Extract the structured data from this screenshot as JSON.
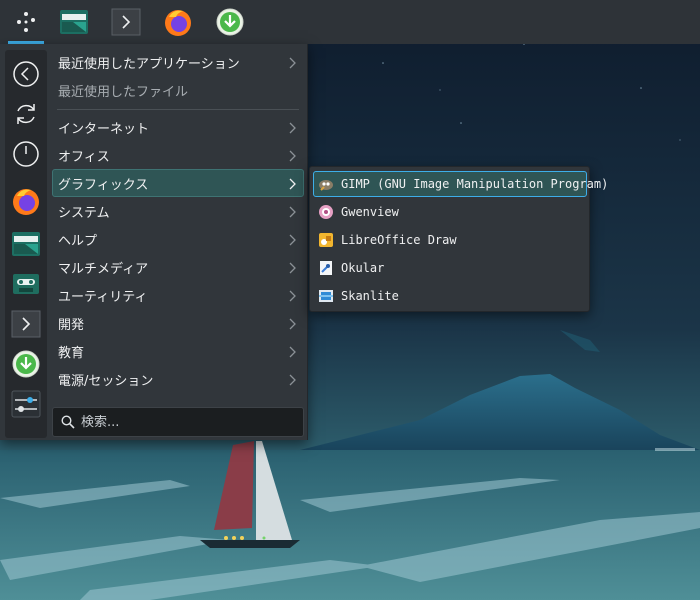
{
  "panel": {
    "items": [
      {
        "name": "application-launcher",
        "icon": "launcher-dots-icon",
        "active": true
      },
      {
        "name": "file-manager",
        "icon": "folder-icon"
      },
      {
        "name": "terminal",
        "icon": "terminal-icon"
      },
      {
        "name": "firefox",
        "icon": "firefox-icon"
      },
      {
        "name": "updater",
        "icon": "download-icon"
      }
    ]
  },
  "sidebar": {
    "items": [
      {
        "icon": "back-arrow-icon"
      },
      {
        "icon": "refresh-icon"
      },
      {
        "icon": "power-icon"
      },
      {
        "icon": "firefox-icon"
      },
      {
        "icon": "folder-icon"
      },
      {
        "icon": "cassette-icon"
      },
      {
        "icon": "terminal-icon"
      },
      {
        "icon": "download-icon"
      },
      {
        "icon": "settings-sliders-icon"
      }
    ]
  },
  "menu": {
    "categories": [
      {
        "label": "最近使用したアプリケーション",
        "has_submenu": true
      },
      {
        "label": "最近使用したファイル",
        "has_submenu": false
      },
      {
        "label": "インターネット",
        "has_submenu": true
      },
      {
        "label": "オフィス",
        "has_submenu": true
      },
      {
        "label": "グラフィックス",
        "has_submenu": true,
        "selected": true
      },
      {
        "label": "システム",
        "has_submenu": true
      },
      {
        "label": "ヘルプ",
        "has_submenu": true
      },
      {
        "label": "マルチメディア",
        "has_submenu": true
      },
      {
        "label": "ユーティリティ",
        "has_submenu": true
      },
      {
        "label": "開発",
        "has_submenu": true
      },
      {
        "label": "教育",
        "has_submenu": true
      },
      {
        "label": "電源/セッション",
        "has_submenu": true
      }
    ],
    "search_placeholder": "検索..."
  },
  "submenu": {
    "items": [
      {
        "label": "GIMP (GNU Image Manipulation Program)",
        "icon": "gimp-icon",
        "selected": true
      },
      {
        "label": "Gwenview",
        "icon": "gwenview-icon"
      },
      {
        "label": "LibreOffice Draw",
        "icon": "libreoffice-draw-icon"
      },
      {
        "label": "Okular",
        "icon": "okular-icon"
      },
      {
        "label": "Skanlite",
        "icon": "skanlite-icon"
      }
    ]
  },
  "colors": {
    "accent": "#3daee9",
    "selection": "#2f5555",
    "panel": "#2e3338",
    "menu": "#31363b"
  }
}
